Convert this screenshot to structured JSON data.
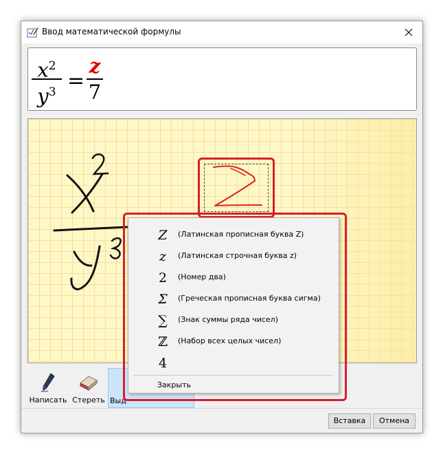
{
  "window": {
    "title": "Ввод математической формулы"
  },
  "icons": {
    "title": "formula-pen-icon",
    "close": "close-icon",
    "write": "pen-icon",
    "erase": "eraser-icon"
  },
  "preview": {
    "left": {
      "num_base": "x",
      "num_exp": "2",
      "den_base": "y",
      "den_exp": "3"
    },
    "equals": "=",
    "right": {
      "num": "z",
      "den": "7"
    }
  },
  "menu": {
    "items": [
      {
        "symbol": "Z",
        "label": "(Латинская прописная буква Z)"
      },
      {
        "symbol": "z",
        "label": "(Латинская строчная буква z)"
      },
      {
        "symbol": "2",
        "label": "(Номер два)"
      },
      {
        "symbol": "Σ",
        "label": "(Греческая прописная буква сигма)"
      },
      {
        "symbol": "∑",
        "label": "(Знак суммы ряда чисел)"
      },
      {
        "symbol": "ℤ",
        "label": "(Набор всех целых чисел)"
      },
      {
        "symbol": "4",
        "label": ""
      }
    ],
    "close": "Закрыть"
  },
  "tools": {
    "write": "Написать",
    "erase": "Стереть",
    "select": "Выд"
  },
  "buttons": {
    "insert": "Вставка",
    "cancel": "Отмена"
  },
  "colors": {
    "highlight": "#d81c2f",
    "recognized": "#e00000",
    "canvas": "#fff7c6"
  }
}
